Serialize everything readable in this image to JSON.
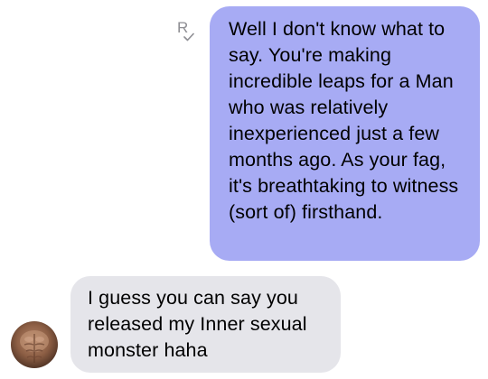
{
  "conversation": {
    "messages": [
      {
        "direction": "outgoing",
        "text": "Well I don't know what to say. You're making incredible leaps for a Man who was relatively inexperienced just a few months ago. As your fag, it's breathtaking to witness (sort of) firsthand."
      },
      {
        "direction": "incoming",
        "text": "I guess you can say you released my Inner sexual monster haha"
      }
    ],
    "receipt_mark": "R"
  },
  "colors": {
    "outgoing_bubble": "#a7abf4",
    "incoming_bubble": "#e5e5ea",
    "receipt_mark": "#8e8e93"
  },
  "icons": {
    "receipt": "read-receipt-icon",
    "avatar": "contact-avatar"
  }
}
